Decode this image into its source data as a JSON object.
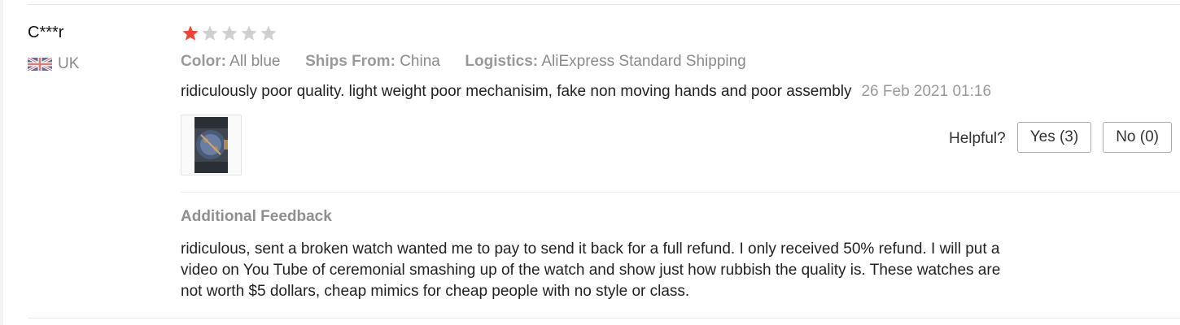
{
  "review": {
    "user_name": "C***r",
    "country": "UK",
    "rating": 1,
    "rating_max": 5,
    "colors": {
      "star_active": "#f44336",
      "star_inactive": "#d0d0d0"
    },
    "meta": {
      "color_label": "Color:",
      "color_value": "All blue",
      "ships_label": "Ships From:",
      "ships_value": "China",
      "logistics_label": "Logistics:",
      "logistics_value": "AliExpress Standard Shipping"
    },
    "text": "ridiculously poor quality. light weight poor mechanisim, fake non moving hands and poor assembly",
    "date": "26 Feb 2021 01:16",
    "helpful_label": "Helpful?",
    "yes_label": "Yes (3)",
    "no_label": "No (0)",
    "additional_title": "Additional Feedback",
    "additional_text": "ridiculous, sent a broken watch wanted me to pay to send it back for a full refund. I only received 50% refund. I will put a video on You Tube of ceremonial smashing up of the watch and show just how rubbish the quality is. These watches are not worth $5 dollars, cheap mimics for cheap people with no style or class."
  }
}
